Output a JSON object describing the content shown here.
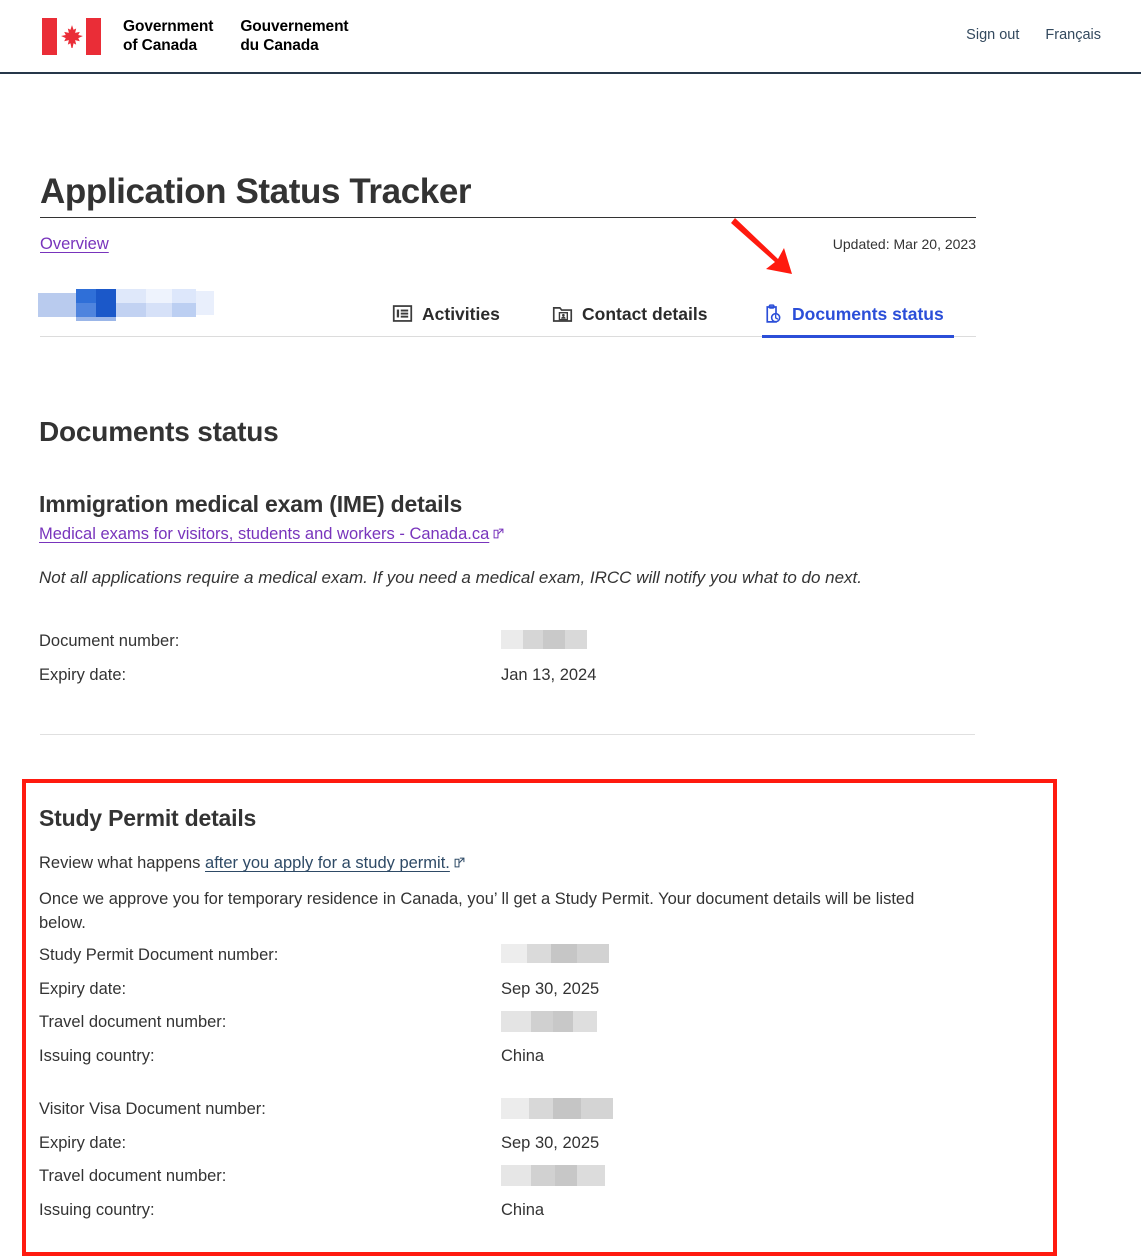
{
  "header": {
    "wordmark_en_line1": "Government",
    "wordmark_en_line2": "of Canada",
    "wordmark_fr_line1": "Gouvernement",
    "wordmark_fr_line2": "du Canada",
    "sign_out": "Sign out",
    "language_toggle": "Français",
    "flag_color": "#ea2d37",
    "border_color": "#26374a"
  },
  "page": {
    "title": "Application Status Tracker",
    "overview_link": "Overview",
    "updated": "Updated: Mar 20, 2023",
    "applicant_name_redacted": ""
  },
  "tabs": [
    {
      "label": "Activities",
      "icon": "list-article-icon",
      "active": false
    },
    {
      "label": "Contact details",
      "icon": "folder-contact-icon",
      "active": false
    },
    {
      "label": "Documents status",
      "icon": "clipboard-clock-icon",
      "active": true
    }
  ],
  "main": {
    "section_title": "Documents status",
    "ime": {
      "heading": "Immigration medical exam (IME) details",
      "link_text": "Medical exams for visitors, students and workers - Canada.ca",
      "note": "Not all applications require a medical exam. If you need a medical exam, IRCC will notify you what to do next.",
      "fields": [
        {
          "label": "Document number:",
          "value": "",
          "redacted": true
        },
        {
          "label": "Expiry date:",
          "value": "Jan 13, 2024",
          "redacted": false
        }
      ]
    },
    "study_permit": {
      "heading": "Study Permit details",
      "review_prefix": "Review what happens ",
      "review_link": "after you apply for a study permit.",
      "paragraph": "Once we approve you for temporary residence in Canada, you’  ll get a Study Permit. Your document details will be listed below.",
      "groups": [
        {
          "fields": [
            {
              "label": "Study Permit Document number:",
              "value": "",
              "redacted": true
            },
            {
              "label": "Expiry date:",
              "value": "Sep 30, 2025",
              "redacted": false
            },
            {
              "label": "Travel document number:",
              "value": "",
              "redacted": true
            },
            {
              "label": "Issuing country:",
              "value": "China",
              "redacted": false
            }
          ]
        },
        {
          "fields": [
            {
              "label": "Visitor Visa Document number:",
              "value": "",
              "redacted": true
            },
            {
              "label": "Expiry date:",
              "value": "Sep 30, 2025",
              "redacted": false
            },
            {
              "label": "Travel document number:",
              "value": "",
              "redacted": true
            },
            {
              "label": "Issuing country:",
              "value": "China",
              "redacted": false
            }
          ]
        }
      ]
    }
  },
  "annotations": {
    "box_color": "#ff1a0f",
    "arrow_color": "#ff1a0f"
  }
}
